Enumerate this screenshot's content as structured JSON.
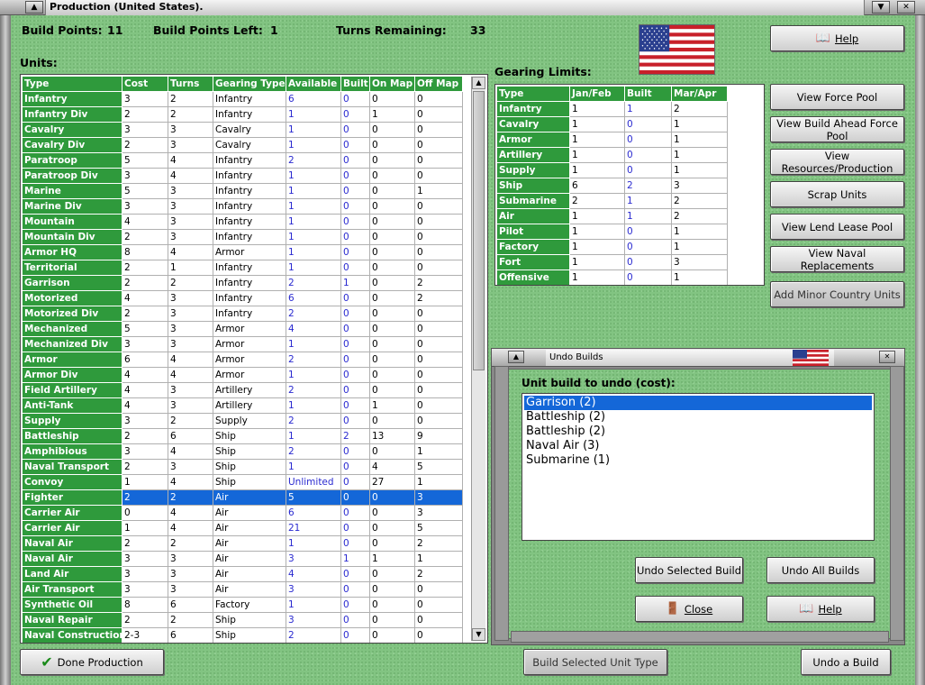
{
  "window": {
    "title": "Production (United States)."
  },
  "stats": {
    "build_points_label": "Build Points:",
    "build_points_value": "11",
    "build_points_left_label": "Build Points Left:",
    "build_points_left_value": "1",
    "turns_remaining_label": "Turns Remaining:",
    "turns_remaining_value": "33"
  },
  "units": {
    "label": "Units:",
    "columns": [
      "Type",
      "Cost",
      "Turns",
      "Gearing Type",
      "Available",
      "Built",
      "On Map",
      "Off Map"
    ],
    "rows": [
      [
        "Infantry",
        "3",
        "2",
        "Infantry",
        "6",
        "0",
        "0",
        "0"
      ],
      [
        "Infantry Div",
        "2",
        "2",
        "Infantry",
        "1",
        "0",
        "1",
        "0"
      ],
      [
        "Cavalry",
        "3",
        "3",
        "Cavalry",
        "1",
        "0",
        "0",
        "0"
      ],
      [
        "Cavalry Div",
        "2",
        "3",
        "Cavalry",
        "1",
        "0",
        "0",
        "0"
      ],
      [
        "Paratroop",
        "5",
        "4",
        "Infantry",
        "2",
        "0",
        "0",
        "0"
      ],
      [
        "Paratroop Div",
        "3",
        "4",
        "Infantry",
        "1",
        "0",
        "0",
        "0"
      ],
      [
        "Marine",
        "5",
        "3",
        "Infantry",
        "1",
        "0",
        "0",
        "1"
      ],
      [
        "Marine Div",
        "3",
        "3",
        "Infantry",
        "1",
        "0",
        "0",
        "0"
      ],
      [
        "Mountain",
        "4",
        "3",
        "Infantry",
        "1",
        "0",
        "0",
        "0"
      ],
      [
        "Mountain Div",
        "2",
        "3",
        "Infantry",
        "1",
        "0",
        "0",
        "0"
      ],
      [
        "Armor HQ",
        "8",
        "4",
        "Armor",
        "1",
        "0",
        "0",
        "0"
      ],
      [
        "Territorial",
        "2",
        "1",
        "Infantry",
        "1",
        "0",
        "0",
        "0"
      ],
      [
        "Garrison",
        "2",
        "2",
        "Infantry",
        "2",
        "1",
        "0",
        "2"
      ],
      [
        "Motorized",
        "4",
        "3",
        "Infantry",
        "6",
        "0",
        "0",
        "2"
      ],
      [
        "Motorized Div",
        "2",
        "3",
        "Infantry",
        "2",
        "0",
        "0",
        "0"
      ],
      [
        "Mechanized",
        "5",
        "3",
        "Armor",
        "4",
        "0",
        "0",
        "0"
      ],
      [
        "Mechanized Div",
        "3",
        "3",
        "Armor",
        "1",
        "0",
        "0",
        "0"
      ],
      [
        "Armor",
        "6",
        "4",
        "Armor",
        "2",
        "0",
        "0",
        "0"
      ],
      [
        "Armor Div",
        "4",
        "4",
        "Armor",
        "1",
        "0",
        "0",
        "0"
      ],
      [
        "Field Artillery",
        "4",
        "3",
        "Artillery",
        "2",
        "0",
        "0",
        "0"
      ],
      [
        "Anti-Tank",
        "4",
        "3",
        "Artillery",
        "1",
        "0",
        "1",
        "0"
      ],
      [
        "Supply",
        "3",
        "2",
        "Supply",
        "2",
        "0",
        "0",
        "0"
      ],
      [
        "Battleship",
        "2",
        "6",
        "Ship",
        "1",
        "2",
        "13",
        "9"
      ],
      [
        "Amphibious",
        "3",
        "4",
        "Ship",
        "2",
        "0",
        "0",
        "1"
      ],
      [
        "Naval Transport",
        "2",
        "3",
        "Ship",
        "1",
        "0",
        "4",
        "5"
      ],
      [
        "Convoy",
        "1",
        "4",
        "Ship",
        "Unlimited",
        "0",
        "27",
        "1"
      ],
      [
        "Fighter",
        "2",
        "2",
        "Air",
        "5",
        "0",
        "0",
        "3"
      ],
      [
        "Carrier Air",
        "0",
        "4",
        "Air",
        "6",
        "0",
        "0",
        "3"
      ],
      [
        "Carrier Air",
        "1",
        "4",
        "Air",
        "21",
        "0",
        "0",
        "5"
      ],
      [
        "Naval Air",
        "2",
        "2",
        "Air",
        "1",
        "0",
        "0",
        "2"
      ],
      [
        "Naval Air",
        "3",
        "3",
        "Air",
        "3",
        "1",
        "1",
        "1"
      ],
      [
        "Land Air",
        "3",
        "3",
        "Air",
        "4",
        "0",
        "0",
        "2"
      ],
      [
        "Air Transport",
        "3",
        "3",
        "Air",
        "3",
        "0",
        "0",
        "0"
      ],
      [
        "Synthetic Oil",
        "8",
        "6",
        "Factory",
        "1",
        "0",
        "0",
        "0"
      ],
      [
        "Naval Repair",
        "2",
        "2",
        "Ship",
        "3",
        "0",
        "0",
        "0"
      ],
      [
        "Naval Construction",
        "2-3",
        "6",
        "Ship",
        "2",
        "0",
        "0",
        "0"
      ]
    ],
    "selected_row": 26
  },
  "gearing": {
    "label": "Gearing Limits:",
    "columns": [
      "Type",
      "Jan/Feb",
      "Built",
      "Mar/Apr"
    ],
    "rows": [
      [
        "Infantry",
        "1",
        "1",
        "2"
      ],
      [
        "Cavalry",
        "1",
        "0",
        "1"
      ],
      [
        "Armor",
        "1",
        "0",
        "1"
      ],
      [
        "Artillery",
        "1",
        "0",
        "1"
      ],
      [
        "Supply",
        "1",
        "0",
        "1"
      ],
      [
        "Ship",
        "6",
        "2",
        "3"
      ],
      [
        "Submarine",
        "2",
        "1",
        "2"
      ],
      [
        "Air",
        "1",
        "1",
        "2"
      ],
      [
        "Pilot",
        "1",
        "0",
        "1"
      ],
      [
        "Factory",
        "1",
        "0",
        "1"
      ],
      [
        "Fort",
        "1",
        "0",
        "3"
      ],
      [
        "Offensive",
        "1",
        "0",
        "1"
      ]
    ]
  },
  "buttons": {
    "help": "Help",
    "view_force_pool": "View Force Pool",
    "view_build_ahead": "View Build Ahead Force Pool",
    "view_resources": "View Resources/Production",
    "scrap_units": "Scrap Units",
    "view_lend_lease": "View Lend Lease Pool",
    "view_naval_replacements": "View Naval Replacements",
    "add_minor": "Add Minor Country Units",
    "done_production": "Done Production",
    "build_selected": "Build Selected Unit Type",
    "undo_a_build": "Undo a Build"
  },
  "undo_panel": {
    "title": "Undo Builds",
    "list_label": "Unit build to undo (cost):",
    "items": [
      "Garrison (2)",
      "Battleship (2)",
      "Battleship (2)",
      "Naval Air (3)",
      "Submarine (1)"
    ],
    "selected_index": 0,
    "undo_selected": "Undo Selected Build",
    "undo_all": "Undo All Builds",
    "close": "Close",
    "help": "Help"
  },
  "colors": {
    "header_green": "#2f9a3c",
    "selection_blue": "#1467d8",
    "value_blue": "#2a2ad0",
    "background_green": "#82c482"
  }
}
